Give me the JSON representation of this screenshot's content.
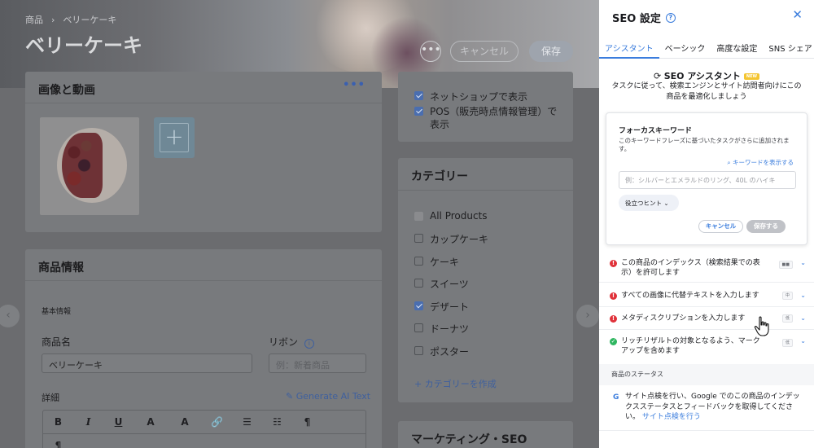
{
  "breadcrumb": {
    "root": "商品",
    "separator": "›",
    "current": "ベリーケーキ"
  },
  "page_title": "ベリーケーキ",
  "header_buttons": {
    "more": "•••",
    "cancel": "キャンセル",
    "save": "保存"
  },
  "media_card": {
    "title": "画像と動画",
    "more": "•••",
    "add": "+"
  },
  "sales_channels": [
    {
      "label": "ネットショップで表示",
      "checked": true
    },
    {
      "label": "POS（販売時点情報管理）で表示",
      "checked": true
    }
  ],
  "categories_card": {
    "title": "カテゴリー",
    "items": [
      {
        "label": "All Products",
        "checked": false
      },
      {
        "label": "カップケーキ",
        "checked": false
      },
      {
        "label": "ケーキ",
        "checked": false
      },
      {
        "label": "スイーツ",
        "checked": false
      },
      {
        "label": "デザート",
        "checked": true
      },
      {
        "label": "ドーナツ",
        "checked": false
      },
      {
        "label": "ポスター",
        "checked": false
      }
    ],
    "create_link": "+ カテゴリーを作成"
  },
  "product_info": {
    "title": "商品情報",
    "section": "基本情報",
    "name_label": "商品名",
    "name_value": "ベリーケーキ",
    "ribbon_label": "リボン",
    "ribbon_placeholder": "例：新着商品",
    "detail_label": "詳細",
    "ai_link": "Generate AI Text",
    "toolbar": [
      "B",
      "I",
      "U",
      "A",
      "A",
      "🔗",
      "☰",
      "☷",
      "¶",
      "¶"
    ]
  },
  "marketing_card": {
    "title": "マーケティング・SEO"
  },
  "seo_panel": {
    "title": "SEO 設定",
    "help": "?",
    "close": "✕",
    "tabs": [
      "アシスタント",
      "ベーシック",
      "高度な設定",
      "SNS シェア"
    ],
    "assistant_title": "SEO アシスタント",
    "new_badge": "NEW",
    "assistant_desc": "タスクに従って、検索エンジンとサイト訪問者向けにこの商品を最適化しましょう",
    "focus": {
      "title": "フォーカスキーワード",
      "desc": "このキーワードフレーズに基づいたタスクがさらに追加されます。",
      "show_link": "キーワードを表示する",
      "placeholder": "例：シルバーとエメラルドのリング、40L のハイキ",
      "hint": "役立つヒント",
      "cancel": "キャンセル",
      "save": "保存する"
    },
    "tasks": [
      {
        "text": "この商品のインデックス（検索結果での表示）を許可します",
        "status": "error",
        "tag": "■■"
      },
      {
        "text": "すべての画像に代替テキストを入力します",
        "status": "error",
        "tag": "中"
      },
      {
        "text": "メタディスクリプションを入力します",
        "status": "error",
        "tag": "低"
      },
      {
        "text": "リッチリザルトの対象となるよう、マークアップを含めます",
        "status": "ok",
        "tag": "低"
      }
    ],
    "status_heading": "商品のステータス",
    "status_text": "サイト点検を行い、Google でのこの商品のインデックスステータスとフィードバックを取得してください。",
    "status_link": "サイト点検を行う",
    "google_icon": "G"
  },
  "nav": {
    "prev": "‹",
    "next": "›"
  }
}
